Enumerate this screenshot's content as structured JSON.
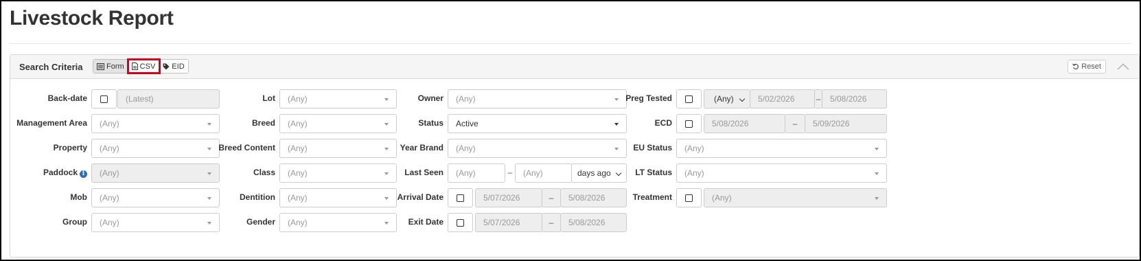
{
  "page": {
    "title": "Livestock Report"
  },
  "panel": {
    "title": "Search Criteria",
    "modes": [
      {
        "label": "Form",
        "icon": "list-icon",
        "active": true
      },
      {
        "label": "CSV",
        "icon": "file-icon",
        "highlighted": true
      },
      {
        "label": "EID",
        "icon": "tag-icon"
      }
    ],
    "reset_label": "Reset",
    "collapse_icon": "chevron-up-icon"
  },
  "fields": {
    "back_date": {
      "label": "Back-date",
      "placeholder": "(Latest)"
    },
    "management_area": {
      "label": "Management Area",
      "value": "(Any)"
    },
    "property": {
      "label": "Property",
      "value": "(Any)"
    },
    "paddock": {
      "label": "Paddock",
      "value": "(Any)",
      "info_icon": "i"
    },
    "mob": {
      "label": "Mob",
      "value": "(Any)"
    },
    "group": {
      "label": "Group",
      "value": "(Any)"
    },
    "lot": {
      "label": "Lot",
      "value": "(Any)"
    },
    "breed": {
      "label": "Breed",
      "value": "(Any)"
    },
    "breed_content": {
      "label": "Breed Content",
      "value": "(Any)"
    },
    "class": {
      "label": "Class",
      "value": "(Any)"
    },
    "dentition": {
      "label": "Dentition",
      "value": "(Any)"
    },
    "gender": {
      "label": "Gender",
      "value": "(Any)"
    },
    "owner": {
      "label": "Owner",
      "value": "(Any)"
    },
    "status": {
      "label": "Status",
      "value": "Active"
    },
    "year_brand": {
      "label": "Year Brand",
      "value": "(Any)"
    },
    "last_seen": {
      "label": "Last Seen",
      "from": "(Any)",
      "to": "(Any)",
      "unit": "days ago",
      "separator": "–"
    },
    "arrival_date": {
      "label": "Arrival Date",
      "from": "5/07/2026",
      "to": "5/08/2026",
      "separator": "–"
    },
    "exit_date": {
      "label": "Exit Date",
      "from": "5/07/2026",
      "to": "5/08/2026",
      "separator": "–"
    },
    "preg_tested": {
      "label": "Preg Tested",
      "result": "(Any)",
      "from": "5/02/2026",
      "to": "5/08/2026",
      "separator": "–"
    },
    "ecd": {
      "label": "ECD",
      "from": "5/08/2026",
      "to": "5/09/2026",
      "separator": "–"
    },
    "eu_status": {
      "label": "EU Status",
      "value": "(Any)"
    },
    "lt_status": {
      "label": "LT Status",
      "value": "(Any)"
    },
    "treatment": {
      "label": "Treatment",
      "value": "(Any)"
    }
  }
}
